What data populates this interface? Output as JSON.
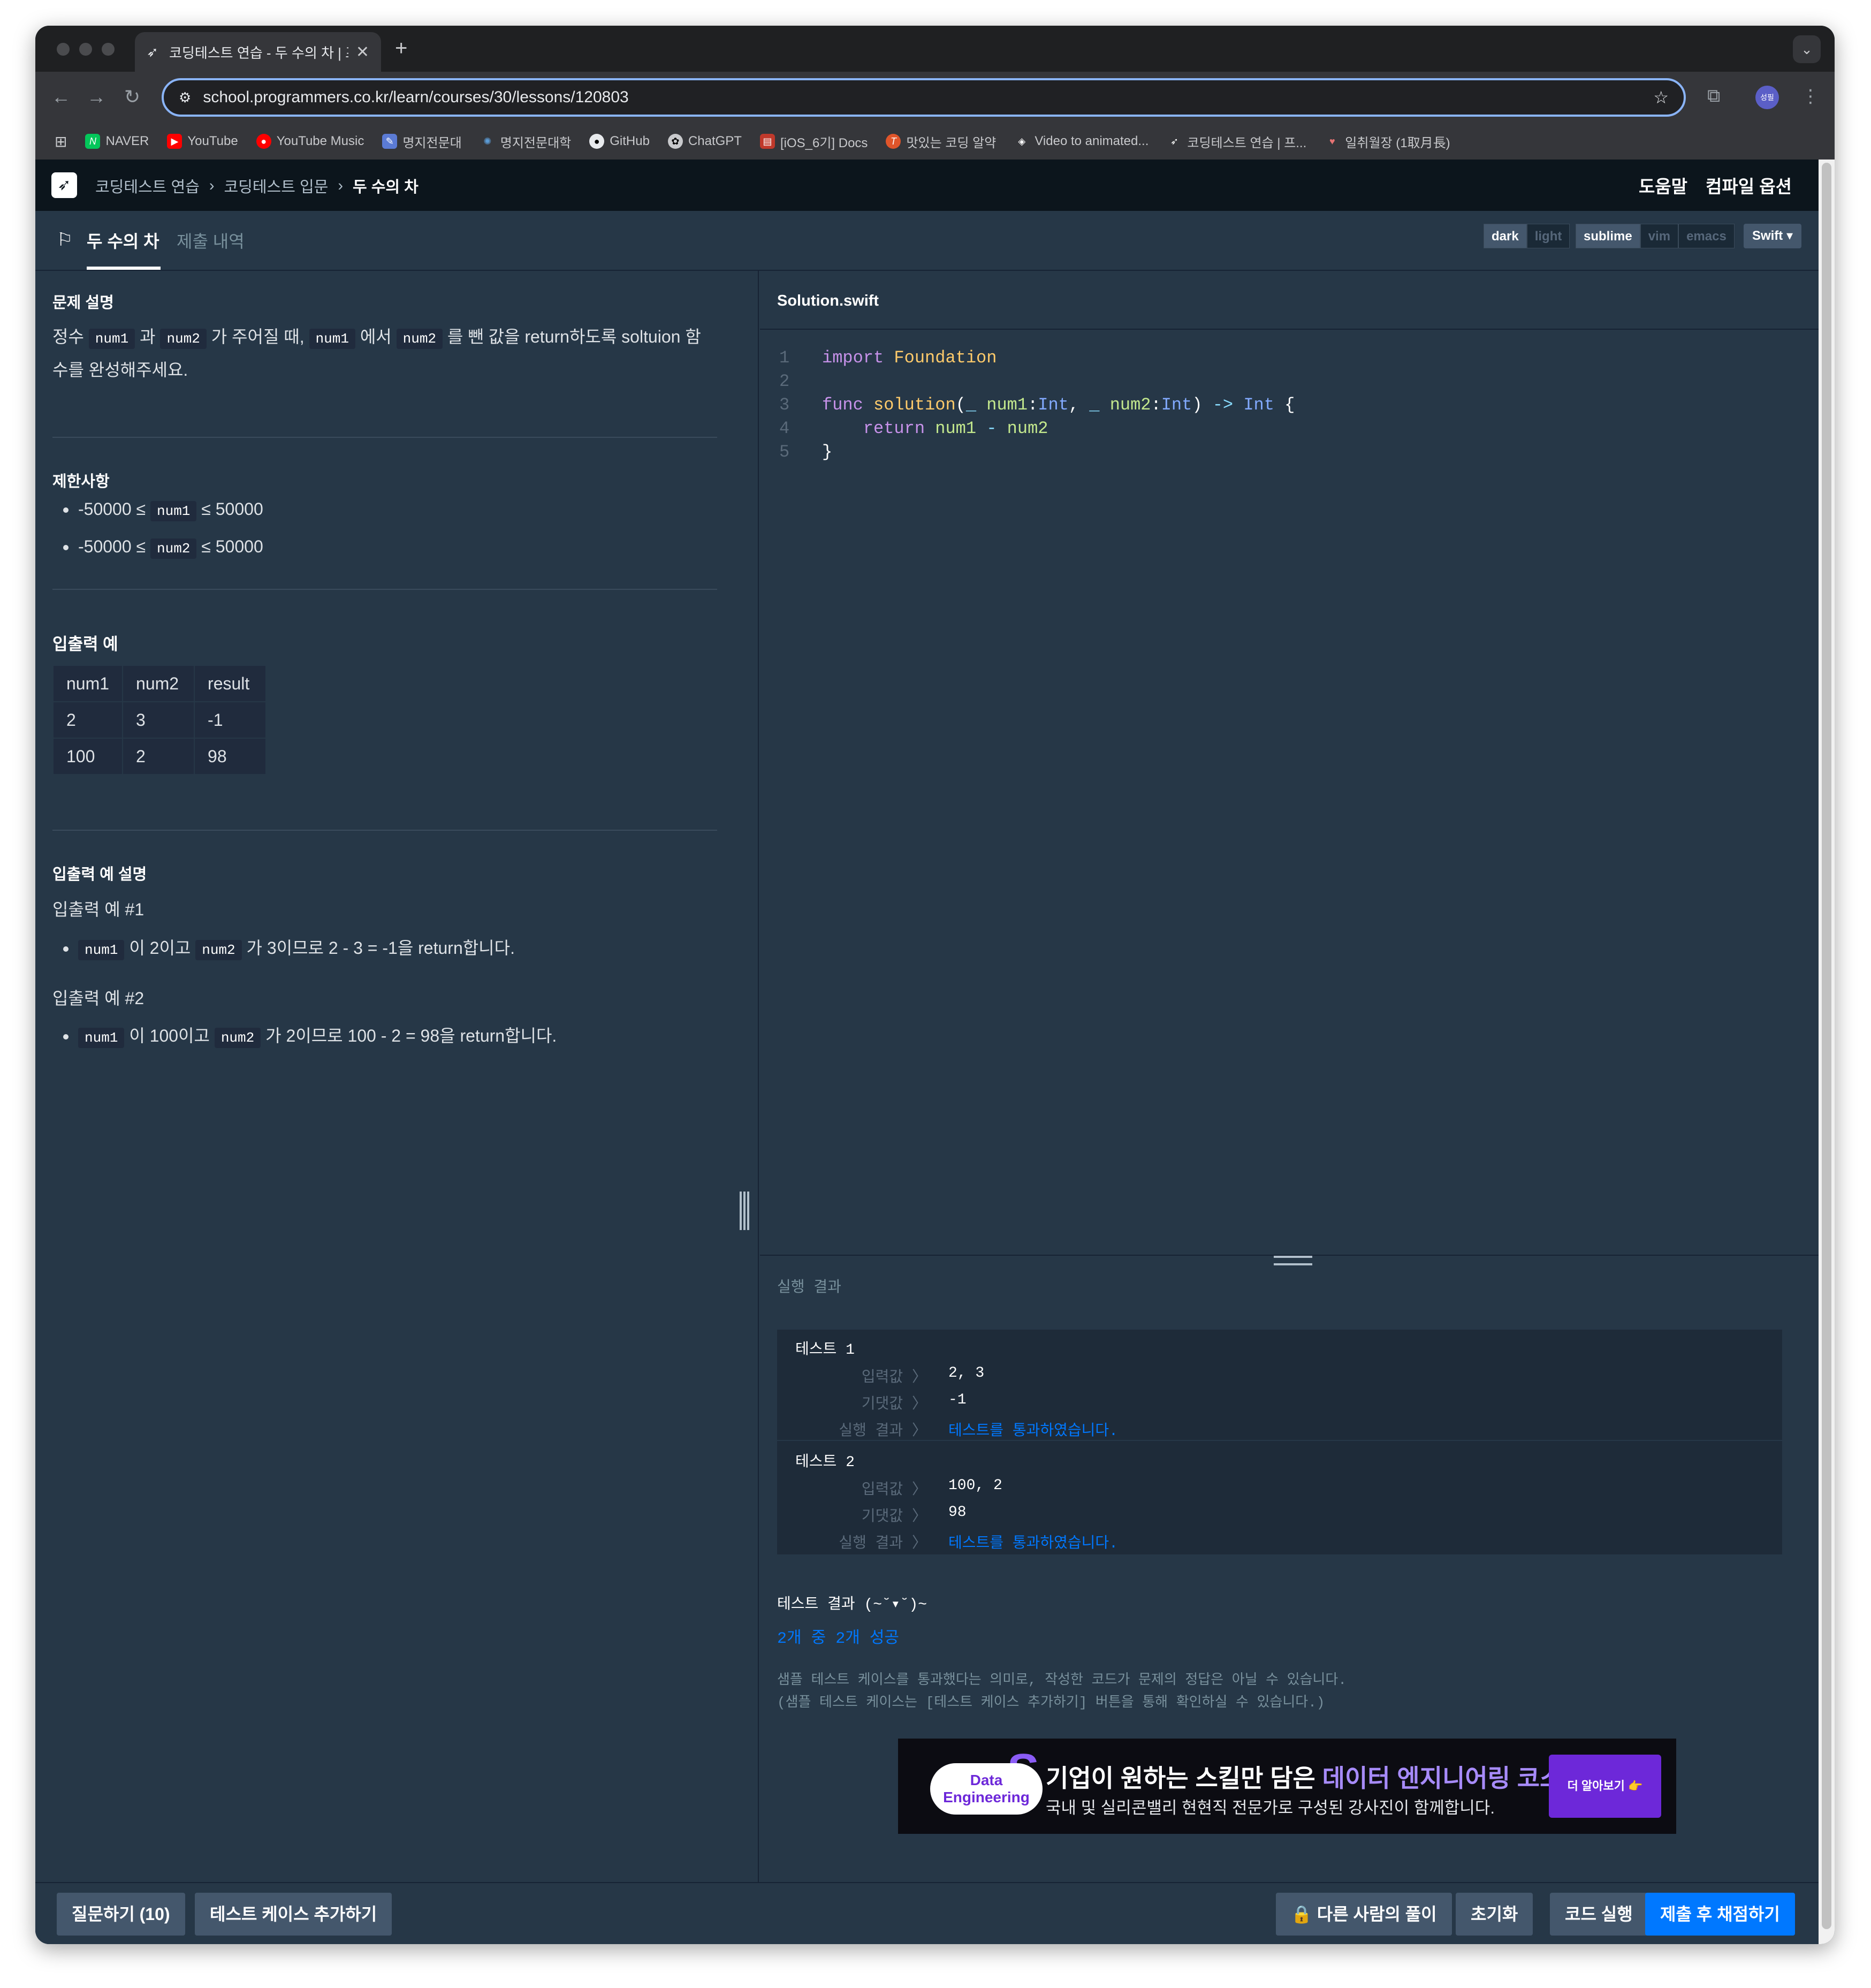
{
  "browser": {
    "tab_title": "코딩테스트 연습 - 두 수의 차 | 프로그래머스",
    "url": "school.programmers.co.kr/learn/courses/30/lessons/120803",
    "profile": "성필",
    "bookmarks": [
      "NAVER",
      "YouTube",
      "YouTube Music",
      "명지전문대",
      "명지전문대학",
      "GitHub",
      "ChatGPT",
      "[iOS_6기] Docs",
      "맛있는 코딩 알약",
      "Video to animated...",
      "코딩테스트 연습 | 프...",
      "일취월장 (1取月長)"
    ]
  },
  "header": {
    "crumbs": [
      "코딩테스트 연습",
      "코딩테스트 입문",
      "두 수의 차"
    ],
    "help": "도움말",
    "compile_options": "컴파일 옵션"
  },
  "subbar": {
    "tab_active": "두 수의 차",
    "tab_inactive": "제출 내역",
    "theme": [
      "dark",
      "light"
    ],
    "keymap": [
      "sublime",
      "vim",
      "emacs"
    ],
    "language": "Swift"
  },
  "problem": {
    "desc_title": "문제 설명",
    "desc_line1": [
      "정수 ",
      "num1",
      " 과 ",
      "num2",
      " 가 주어질 때, ",
      "num1",
      " 에서 ",
      "num2",
      " 를 뺀 값을 return하도록 soltuion 함"
    ],
    "desc_line2": "수를 완성해주세요.",
    "constraints_title": "제한사항",
    "constraints": [
      {
        "pre": "-50000 ≤ ",
        "code": "num1",
        "post": " ≤ 50000"
      },
      {
        "pre": "-50000 ≤ ",
        "code": "num2",
        "post": " ≤ 50000"
      }
    ],
    "io_title": "입출력 예",
    "io_table": {
      "headers": [
        "num1",
        "num2",
        "result"
      ],
      "rows": [
        [
          "2",
          "3",
          "-1"
        ],
        [
          "100",
          "2",
          "98"
        ]
      ]
    },
    "explain_title": "입출력 예 설명",
    "ex1_title": "입출력 예 #1",
    "ex1": {
      "c1": "num1",
      "t1": " 이 2이고 ",
      "c2": "num2",
      "t2": " 가 3이므로 2 - 3 = -1을 return합니다."
    },
    "ex2_title": "입출력 예 #2",
    "ex2": {
      "c1": "num1",
      "t1": " 이 100이고 ",
      "c2": "num2",
      "t2": " 가 2이므로 100 - 2 = 98을 return합니다."
    }
  },
  "editor": {
    "filename": "Solution.swift",
    "line_numbers": [
      "1",
      "2",
      "3",
      "4",
      "5"
    ]
  },
  "result": {
    "title": "실행 결과",
    "tests": [
      {
        "name": "테스트 1",
        "input": "2, 3",
        "expected": "-1",
        "result": "테스트를 통과하였습니다."
      },
      {
        "name": "테스트 2",
        "input": "100, 2",
        "expected": "98",
        "result": "테스트를 통과하였습니다."
      }
    ],
    "labels": {
      "input": "입력값 〉",
      "expected": "기댓값 〉",
      "result": "실행 결과 〉"
    },
    "summary_title": "테스트 결과 (~˘▾˘)~",
    "summary": "2개 중 2개 성공",
    "note": "샘플 테스트 케이스를 통과했다는 의미로, 작성한 코드가 문제의 정답은 아닐 수 있습니다.\n(샘플 테스트 케이스는 [테스트 케이스 추가하기] 버튼을 통해 확인하실 수 있습니다.)"
  },
  "banner": {
    "badge": "Data Engineering",
    "headline_pre": "기업이 원하는 스킬만 담은 ",
    "headline_accent": "데이터 엔지니어링 코스",
    "sub": "국내 및 실리콘밸리 현현직 전문가로 구성된 강사진이 함께합니다.",
    "cta": "더 알아보기 👉"
  },
  "bottom": {
    "ask": "질문하기 (10)",
    "add_case": "테스트 케이스 추가하기",
    "others": "다른 사람의 풀이",
    "reset": "초기화",
    "run": "코드 실행",
    "submit": "제출 후 채점하기"
  }
}
